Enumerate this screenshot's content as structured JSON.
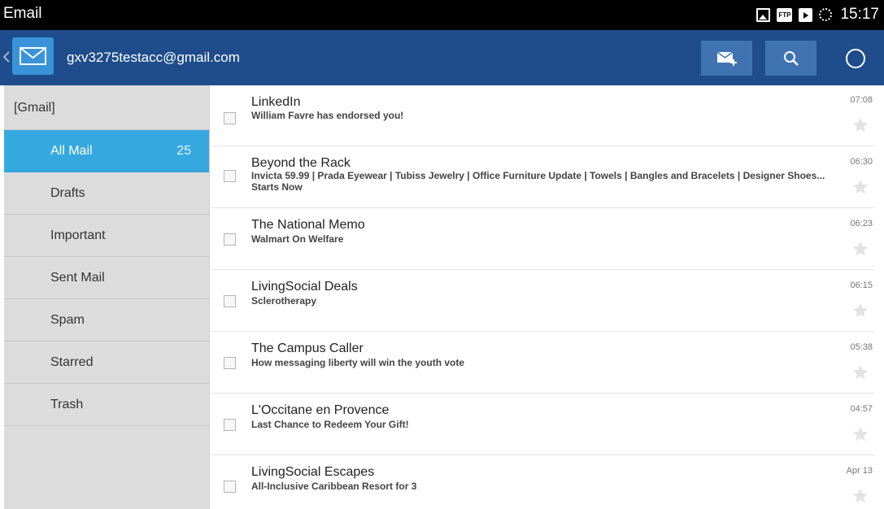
{
  "statusbar": {
    "title": "Email",
    "ftp_label": "FTP",
    "time": "15:17",
    "icons": [
      "image-icon",
      "ftp-icon",
      "store-icon",
      "sync-icon"
    ]
  },
  "actionbar": {
    "account": "gxv3275testacc@gmail.com",
    "icons": [
      "email-app-icon",
      "compose-icon",
      "search-icon",
      "refresh-icon"
    ]
  },
  "sidebar": {
    "header": "[Gmail]",
    "folders": [
      {
        "label": "All Mail",
        "count": "25",
        "selected": true
      },
      {
        "label": "Drafts",
        "count": ""
      },
      {
        "label": "Important",
        "count": ""
      },
      {
        "label": "Sent Mail",
        "count": ""
      },
      {
        "label": "Spam",
        "count": ""
      },
      {
        "label": "Starred",
        "count": ""
      },
      {
        "label": "Trash",
        "count": ""
      }
    ]
  },
  "messages": [
    {
      "sender": "LinkedIn",
      "subject": "William Favre has endorsed you!",
      "time": "07:08"
    },
    {
      "sender": "Beyond the Rack",
      "subject": "Invicta 59.99 | Prada Eyewear | Tubiss Jewelry | Office Furniture Update | Towels | Bangles and Bracelets | Designer Shoes... Starts Now",
      "time": "06:30"
    },
    {
      "sender": "The National Memo",
      "subject": "Walmart On Welfare",
      "time": "06:23"
    },
    {
      "sender": "LivingSocial Deals",
      "subject": "Sclerotherapy",
      "time": "06:15"
    },
    {
      "sender": "The Campus Caller",
      "subject": "How messaging liberty will win the youth vote",
      "time": "05:38"
    },
    {
      "sender": "L'Occitane en Provence",
      "subject": "Last Chance to Redeem Your Gift!",
      "time": "04:57"
    },
    {
      "sender": "LivingSocial Escapes",
      "subject": "All-Inclusive Caribbean Resort for 3",
      "time": "Apr 13"
    }
  ],
  "colors": {
    "actionbar": "#1f4d8b",
    "selected_folder": "#35a8e0",
    "sidebar": "#dcdcdc"
  }
}
